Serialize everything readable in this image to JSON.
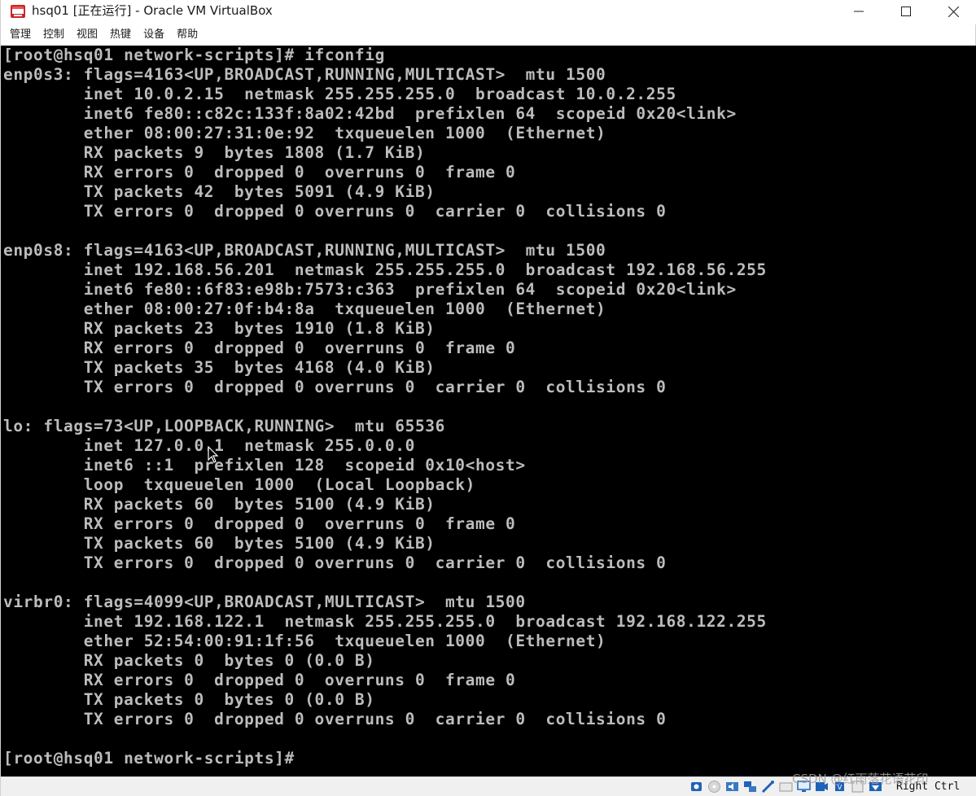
{
  "window": {
    "title": "hsq01 [正在运行] - Oracle VM VirtualBox",
    "controls": [
      "minimize",
      "maximize",
      "close"
    ]
  },
  "menu": {
    "items": [
      "管理",
      "控制",
      "视图",
      "热键",
      "设备",
      "帮助"
    ]
  },
  "console": {
    "lines": [
      "[root@hsq01 network-scripts]# ifconfig",
      "enp0s3: flags=4163<UP,BROADCAST,RUNNING,MULTICAST>  mtu 1500",
      "        inet 10.0.2.15  netmask 255.255.255.0  broadcast 10.0.2.255",
      "        inet6 fe80::c82c:133f:8a02:42bd  prefixlen 64  scopeid 0x20<link>",
      "        ether 08:00:27:31:0e:92  txqueuelen 1000  (Ethernet)",
      "        RX packets 9  bytes 1808 (1.7 KiB)",
      "        RX errors 0  dropped 0  overruns 0  frame 0",
      "        TX packets 42  bytes 5091 (4.9 KiB)",
      "        TX errors 0  dropped 0 overruns 0  carrier 0  collisions 0",
      "",
      "enp0s8: flags=4163<UP,BROADCAST,RUNNING,MULTICAST>  mtu 1500",
      "        inet 192.168.56.201  netmask 255.255.255.0  broadcast 192.168.56.255",
      "        inet6 fe80::6f83:e98b:7573:c363  prefixlen 64  scopeid 0x20<link>",
      "        ether 08:00:27:0f:b4:8a  txqueuelen 1000  (Ethernet)",
      "        RX packets 23  bytes 1910 (1.8 KiB)",
      "        RX errors 0  dropped 0  overruns 0  frame 0",
      "        TX packets 35  bytes 4168 (4.0 KiB)",
      "        TX errors 0  dropped 0 overruns 0  carrier 0  collisions 0",
      "",
      "lo: flags=73<UP,LOOPBACK,RUNNING>  mtu 65536",
      "        inet 127.0.0.1  netmask 255.0.0.0",
      "        inet6 ::1  prefixlen 128  scopeid 0x10<host>",
      "        loop  txqueuelen 1000  (Local Loopback)",
      "        RX packets 60  bytes 5100 (4.9 KiB)",
      "        RX errors 0  dropped 0  overruns 0  frame 0",
      "        TX packets 60  bytes 5100 (4.9 KiB)",
      "        TX errors 0  dropped 0 overruns 0  carrier 0  collisions 0",
      "",
      "virbr0: flags=4099<UP,BROADCAST,MULTICAST>  mtu 1500",
      "        inet 192.168.122.1  netmask 255.255.255.0  broadcast 192.168.122.255",
      "        ether 52:54:00:91:1f:56  txqueuelen 1000  (Ethernet)",
      "        RX packets 0  bytes 0 (0.0 B)",
      "        RX errors 0  dropped 0  overruns 0  frame 0",
      "        TX packets 0  bytes 0 (0.0 B)",
      "        TX errors 0  dropped 0 overruns 0  carrier 0  collisions 0",
      "",
      "[root@hsq01 network-scripts]#"
    ]
  },
  "statusbar": {
    "icons": [
      "hard-disk-icon",
      "optical-disk-icon",
      "audio-icon",
      "network-icon",
      "usb-icon",
      "shared-folders-icon",
      "display-icon",
      "video-capture-icon",
      "cpu-icon",
      "mouse-integration-icon",
      "keyboard-icon"
    ],
    "host_key": "Right Ctrl"
  },
  "watermark": "CSDN @红雨落花语花印",
  "colors": {
    "console_bg": "#000000",
    "console_fg": "#bcbcbc",
    "window_bg": "#ffffff",
    "statusbar_bg": "#f0f0f0"
  }
}
